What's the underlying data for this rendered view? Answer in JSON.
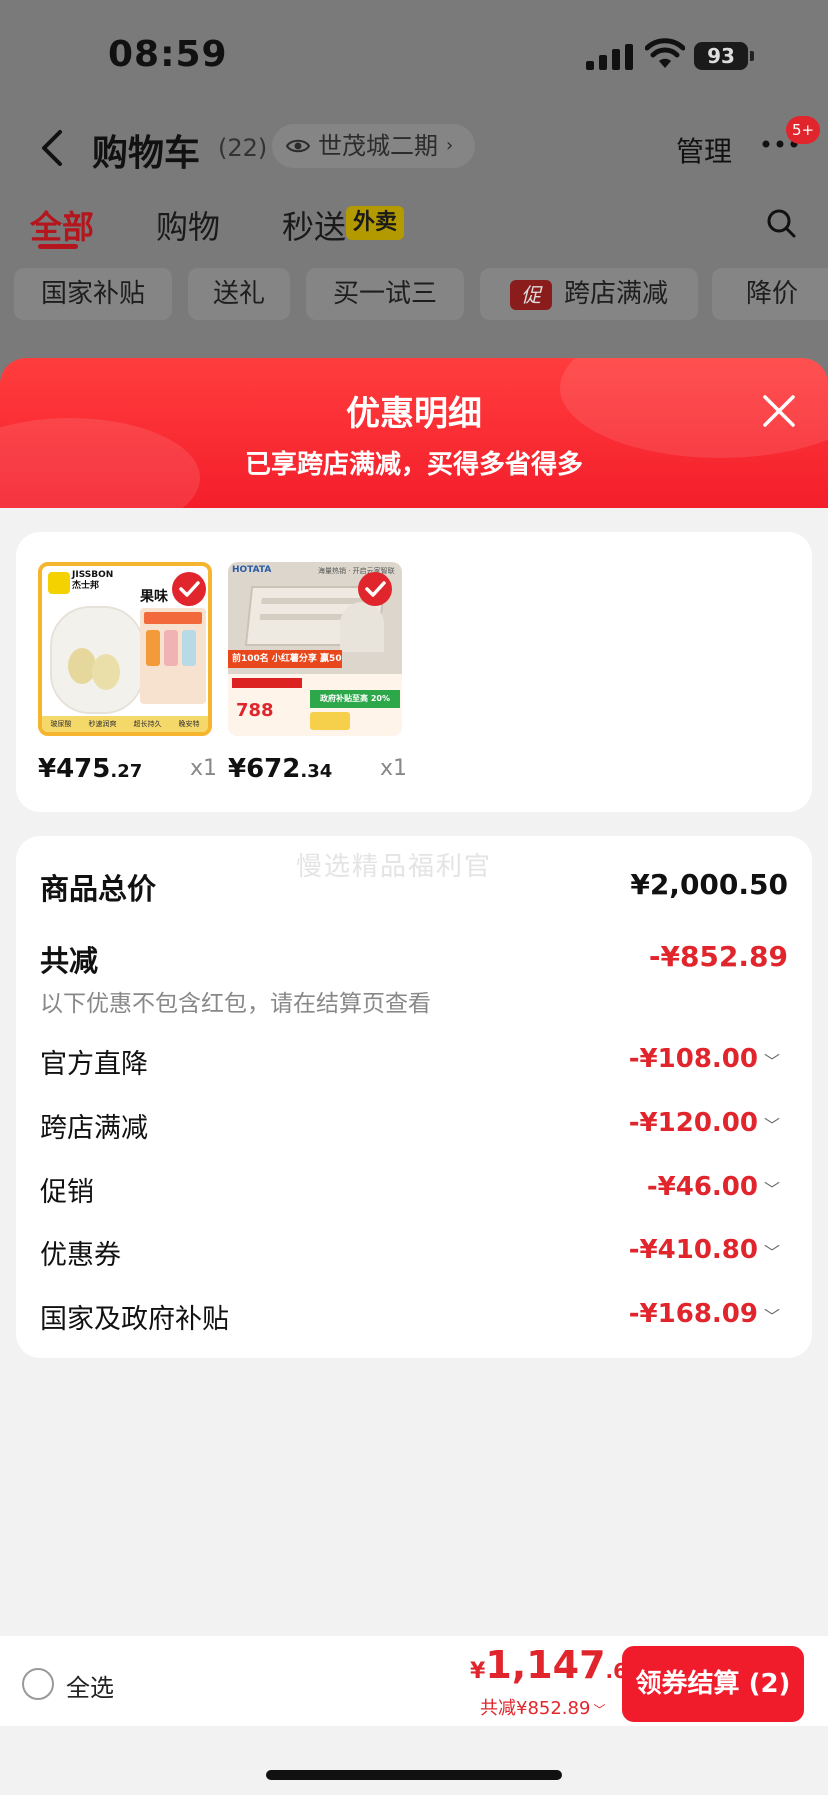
{
  "status": {
    "time": "08:59",
    "battery": "93"
  },
  "header": {
    "title": "购物车",
    "count": "(22)",
    "location": "世茂城二期",
    "manage": "管理",
    "more_badge": "5+"
  },
  "tabs": [
    {
      "label": "全部"
    },
    {
      "label": "购物"
    },
    {
      "label": "秒送"
    }
  ],
  "waimai_badge": "外卖",
  "chips": [
    {
      "label": "国家补贴"
    },
    {
      "label": "送礼"
    },
    {
      "label": "买一试三"
    },
    {
      "label": "跨店满减",
      "tag": "促"
    },
    {
      "label": "降价"
    }
  ],
  "sheet": {
    "title": "优惠明细",
    "subtitle": "已享跨店满减，买得多省得多"
  },
  "products": [
    {
      "brand": "JISSBON",
      "brand_cn": "杰士邦",
      "badge": "果味",
      "price_int": "¥475",
      "price_dec": ".27",
      "qty": "x1",
      "promo_lines": [
        "金装清凉",
        "沐浴享受",
        "滋润保湿"
      ],
      "footer_tags": [
        "玻尿酸",
        "秒速润爽",
        "超长持久",
        "晚安特"
      ]
    },
    {
      "brand": "HOTATA",
      "brand_cn": "好太太",
      "price_int": "¥672",
      "price_dec": ".34",
      "qty": "x1",
      "top_text": "海量热销 · 开启云家智联",
      "promo1": "前100名 小红薯分享 赢50元",
      "promo2": "政府补贴至高 20%",
      "price_tag": "788"
    }
  ],
  "summary": {
    "watermark": "慢选精品福利官",
    "total_label": "商品总价",
    "total_value": "¥2,000.50",
    "reduce_label": "共减",
    "reduce_value": "-¥852.89",
    "note": "以下优惠不包含红包，请在结算页查看",
    "items": [
      {
        "label": "官方直降",
        "value": "-¥108.00"
      },
      {
        "label": "跨店满减",
        "value": "-¥120.00"
      },
      {
        "label": "促销",
        "value": "-¥46.00"
      },
      {
        "label": "优惠券",
        "value": "-¥410.80"
      },
      {
        "label": "国家及政府补贴",
        "value": "-¥168.09"
      }
    ]
  },
  "bottom": {
    "select_all": "全选",
    "yen": "¥",
    "price_int": "1,147",
    "price_dec": ".61",
    "reduce": "共减¥852.89",
    "checkout": "领券结算 (2)"
  },
  "colors": {
    "accent": "#e0252c",
    "header_red": "#f41e2b"
  }
}
